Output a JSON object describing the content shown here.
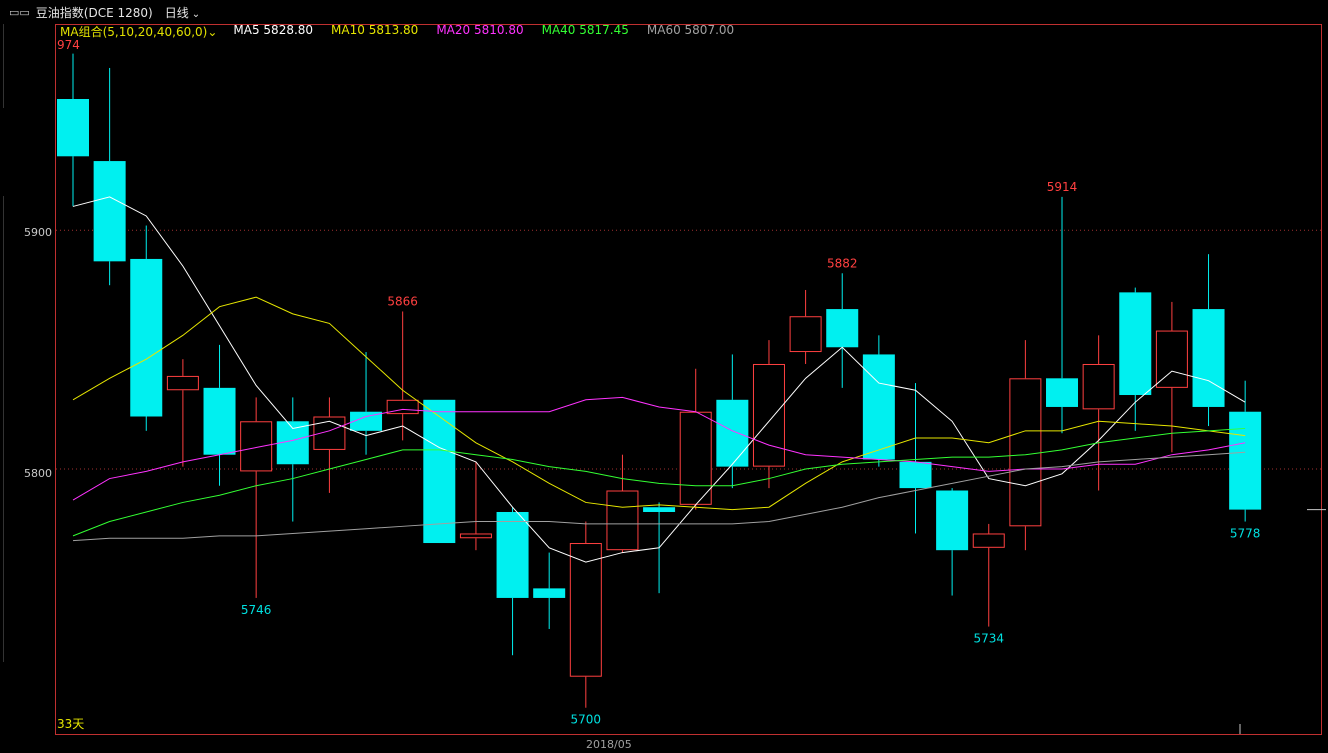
{
  "topbar": {
    "icon": "window-restore-icon",
    "icon_glyph": "▭▭",
    "title": "豆油指数(DCE 1280)",
    "period": "日线",
    "period_caret": "⌄"
  },
  "legend": {
    "combo": "MA组合(5,10,20,40,60,0)⌄",
    "items": [
      {
        "label": "MA5 5828.80",
        "color": "#ffffff"
      },
      {
        "label": "MA10 5813.80",
        "color": "#e6e600"
      },
      {
        "label": "MA20 5810.80",
        "color": "#ff33ff"
      },
      {
        "label": "MA40 5817.45",
        "color": "#33ff33"
      },
      {
        "label": "MA60 5807.00",
        "color": "#a0a0a0"
      }
    ]
  },
  "yaxis": {
    "labels": [
      "5900",
      "5800"
    ]
  },
  "xaxis": {
    "label": "2018/05"
  },
  "footer": {
    "bar_count": "33天"
  },
  "chart_data": {
    "type": "candlestick",
    "ylim": [
      5689,
      5986
    ],
    "grid_levels": [
      5900,
      5800
    ],
    "colors": {
      "up": "#ff4040",
      "down": "#00f0f0"
    },
    "candles": [
      {
        "o": 5955,
        "h": 5974,
        "l": 5910,
        "c": 5931
      },
      {
        "o": 5929,
        "h": 5968,
        "l": 5877,
        "c": 5887
      },
      {
        "o": 5888,
        "h": 5902,
        "l": 5816,
        "c": 5822
      },
      {
        "o": 5833,
        "h": 5846,
        "l": 5801,
        "c": 5839
      },
      {
        "o": 5834,
        "h": 5852,
        "l": 5793,
        "c": 5806
      },
      {
        "o": 5799,
        "h": 5830,
        "l": 5746,
        "c": 5820
      },
      {
        "o": 5820,
        "h": 5830,
        "l": 5778,
        "c": 5802
      },
      {
        "o": 5808,
        "h": 5830,
        "l": 5790,
        "c": 5822
      },
      {
        "o": 5824,
        "h": 5849,
        "l": 5806,
        "c": 5816
      },
      {
        "o": 5823,
        "h": 5866,
        "l": 5812,
        "c": 5829
      },
      {
        "o": 5829,
        "h": 5829,
        "l": 5770,
        "c": 5769
      },
      {
        "o": 5771,
        "h": 5803,
        "l": 5766,
        "c": 5773
      },
      {
        "o": 5782,
        "h": 5784,
        "l": 5722,
        "c": 5746
      },
      {
        "o": 5750,
        "h": 5765,
        "l": 5733,
        "c": 5746
      },
      {
        "o": 5713,
        "h": 5778,
        "l": 5700,
        "c": 5769
      },
      {
        "o": 5766,
        "h": 5806,
        "l": 5765,
        "c": 5791
      },
      {
        "o": 5784,
        "h": 5786,
        "l": 5748,
        "c": 5782
      },
      {
        "o": 5785,
        "h": 5842,
        "l": 5783,
        "c": 5824
      },
      {
        "o": 5829,
        "h": 5848,
        "l": 5792,
        "c": 5801
      },
      {
        "o": 5801,
        "h": 5854,
        "l": 5792,
        "c": 5844
      },
      {
        "o": 5849,
        "h": 5875,
        "l": 5844,
        "c": 5864
      },
      {
        "o": 5867,
        "h": 5882,
        "l": 5834,
        "c": 5851
      },
      {
        "o": 5848,
        "h": 5856,
        "l": 5801,
        "c": 5804
      },
      {
        "o": 5803,
        "h": 5836,
        "l": 5773,
        "c": 5792
      },
      {
        "o": 5791,
        "h": 5792,
        "l": 5747,
        "c": 5766
      },
      {
        "o": 5767,
        "h": 5777,
        "l": 5734,
        "c": 5773
      },
      {
        "o": 5776,
        "h": 5854,
        "l": 5766,
        "c": 5838
      },
      {
        "o": 5838,
        "h": 5914,
        "l": 5815,
        "c": 5826
      },
      {
        "o": 5825,
        "h": 5856,
        "l": 5791,
        "c": 5844
      },
      {
        "o": 5874,
        "h": 5876,
        "l": 5816,
        "c": 5831
      },
      {
        "o": 5834,
        "h": 5870,
        "l": 5807,
        "c": 5858
      },
      {
        "o": 5867,
        "h": 5890,
        "l": 5818,
        "c": 5826
      },
      {
        "o": 5824,
        "h": 5837,
        "l": 5778,
        "c": 5783
      }
    ],
    "annotations": [
      {
        "index": 0,
        "value": 5974,
        "label": "974",
        "color": "#ff4040",
        "pos": "above"
      },
      {
        "index": 5,
        "value": 5746,
        "label": "5746",
        "color": "#00e0e0",
        "pos": "below"
      },
      {
        "index": 9,
        "value": 5866,
        "label": "5866",
        "color": "#ff4040",
        "pos": "above"
      },
      {
        "index": 14,
        "value": 5700,
        "label": "5700",
        "color": "#00e0e0",
        "pos": "below"
      },
      {
        "index": 21,
        "value": 5882,
        "label": "5882",
        "color": "#ff4040",
        "pos": "above"
      },
      {
        "index": 25,
        "value": 5734,
        "label": "5734",
        "color": "#00e0e0",
        "pos": "below"
      },
      {
        "index": 27,
        "value": 5914,
        "label": "5914",
        "color": "#ff4040",
        "pos": "above"
      },
      {
        "index": 32,
        "value": 5778,
        "label": "5778",
        "color": "#00e0e0",
        "pos": "below"
      }
    ],
    "series": [
      {
        "name": "MA5",
        "color": "#ffffff",
        "values": [
          5910,
          5914,
          5906,
          5885,
          5860,
          5835,
          5817,
          5820,
          5814,
          5818,
          5809,
          5803,
          5784,
          5767,
          5761,
          5765,
          5767,
          5785,
          5802,
          5820,
          5838,
          5851,
          5836,
          5833,
          5820,
          5796,
          5793,
          5798,
          5812,
          5828,
          5841,
          5837,
          5828
        ]
      },
      {
        "name": "MA10",
        "color": "#e6e600",
        "values": [
          5829,
          5838,
          5846,
          5856,
          5868,
          5872,
          5865,
          5861,
          5847,
          5833,
          5822,
          5811,
          5803,
          5794,
          5786,
          5784,
          5785,
          5784,
          5783,
          5784,
          5794,
          5803,
          5808,
          5813,
          5813,
          5811,
          5816,
          5816,
          5820,
          5819,
          5818,
          5816,
          5814
        ]
      },
      {
        "name": "MA20",
        "color": "#ff33ff",
        "values": [
          5787,
          5796,
          5799,
          5803,
          5806,
          5809,
          5812,
          5816,
          5822,
          5825,
          5824,
          5824,
          5824,
          5824,
          5829,
          5830,
          5826,
          5824,
          5816,
          5810,
          5806,
          5805,
          5804,
          5803,
          5801,
          5799,
          5800,
          5800,
          5802,
          5802,
          5806,
          5808,
          5811
        ]
      },
      {
        "name": "MA40",
        "color": "#33ff33",
        "values": [
          5772,
          5778,
          5782,
          5786,
          5789,
          5793,
          5796,
          5800,
          5804,
          5808,
          5808,
          5806,
          5804,
          5801,
          5799,
          5796,
          5794,
          5793,
          5793,
          5796,
          5800,
          5802,
          5803,
          5804,
          5805,
          5805,
          5806,
          5808,
          5811,
          5813,
          5815,
          5816,
          5817
        ]
      },
      {
        "name": "MA60",
        "color": "#a0a0a0",
        "values": [
          5770,
          5771,
          5771,
          5771,
          5772,
          5772,
          5773,
          5774,
          5775,
          5776,
          5777,
          5778,
          5778,
          5778,
          5777,
          5777,
          5777,
          5777,
          5777,
          5778,
          5781,
          5784,
          5788,
          5791,
          5794,
          5797,
          5800,
          5801,
          5803,
          5804,
          5805,
          5806,
          5807
        ]
      }
    ],
    "current_price": 5783
  }
}
